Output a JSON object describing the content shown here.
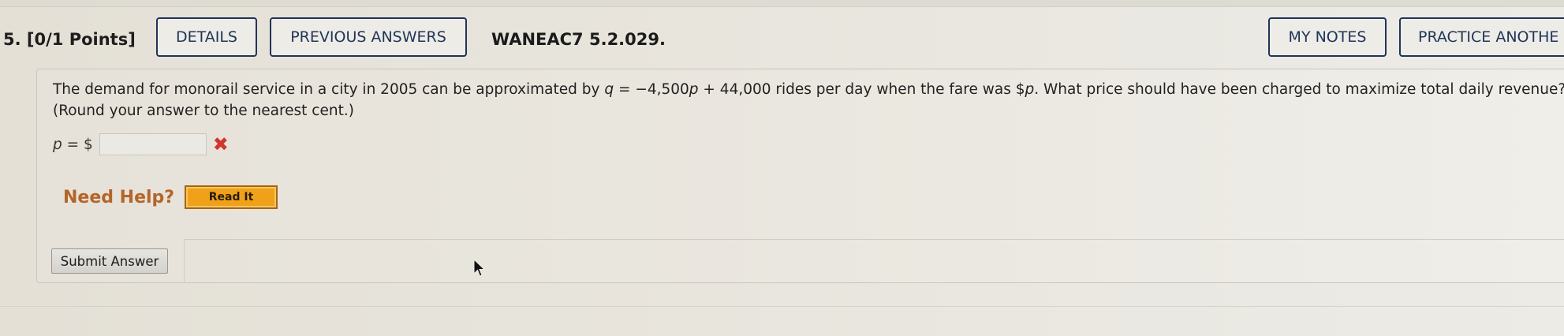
{
  "header": {
    "question_number": "5.",
    "points": "[0/1 Points]",
    "details_label": "DETAILS",
    "previous_answers_label": "PREVIOUS ANSWERS",
    "problem_code": "WANEAC7 5.2.029.",
    "my_notes_label": "MY NOTES",
    "practice_label": "PRACTICE ANOTHE"
  },
  "question": {
    "text_1": "The demand for monorail service in a city in 2005 can be approximated by ",
    "var_q": "q",
    "text_2": " = −4,500",
    "var_p1": "p",
    "text_3": " + 44,000 rides per day when the fare was $",
    "var_p2": "p",
    "text_4": ". What price should have been charged to maximize total daily revenue? (Round your answer to the nearest cent.)"
  },
  "answer": {
    "var_p": "p",
    "label_suffix": " = $",
    "value": "",
    "status_icon": "x-mark-icon",
    "status_mark": "✖",
    "status_color": "#d1352b"
  },
  "help": {
    "label": "Need Help?",
    "read_it_label": "Read It"
  },
  "submit": {
    "label": "Submit Answer"
  }
}
